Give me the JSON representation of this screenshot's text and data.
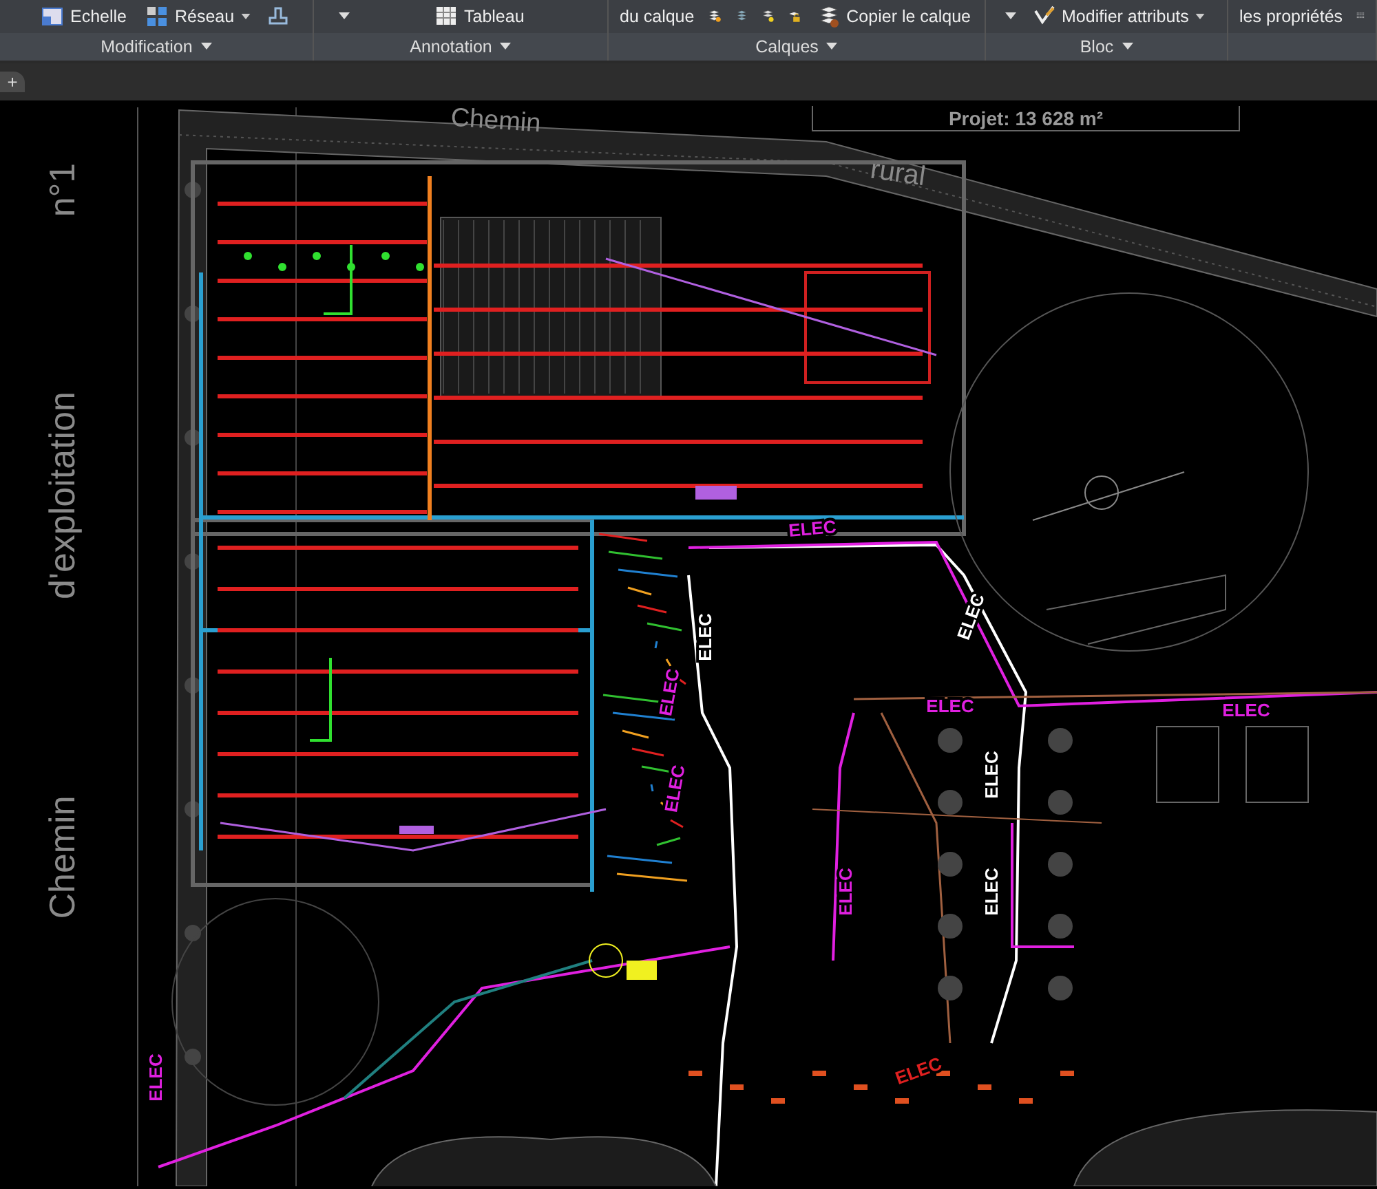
{
  "ribbon": {
    "panels": [
      {
        "title": "Modification",
        "tools": [
          {
            "kind": "button",
            "label": "Echelle"
          },
          {
            "kind": "dropdown",
            "label": "Réseau"
          },
          {
            "kind": "icon"
          }
        ]
      },
      {
        "title": "Annotation",
        "tools": [
          {
            "kind": "caret"
          },
          {
            "kind": "button",
            "label": "Tableau"
          }
        ]
      },
      {
        "title": "Calques",
        "tools": [
          {
            "kind": "text",
            "label": "du calque"
          },
          {
            "kind": "icon"
          },
          {
            "kind": "icon"
          },
          {
            "kind": "icon"
          },
          {
            "kind": "icon"
          },
          {
            "kind": "button",
            "label": "Copier le calque"
          }
        ]
      },
      {
        "title": "Bloc",
        "tools": [
          {
            "kind": "caret"
          },
          {
            "kind": "dropdown",
            "label": "Modifier attributs"
          }
        ]
      },
      {
        "tools": [
          {
            "kind": "text",
            "label": "les propriétés"
          },
          {
            "kind": "icon"
          }
        ]
      }
    ]
  },
  "file_tabs": [
    {
      "label": "+"
    }
  ],
  "drawing": {
    "road_labels": [
      "Chemin",
      "rural",
      "n°1",
      "d'exploitation",
      "Chemin"
    ],
    "area_label": "Projet: 13 628 m²",
    "cable_labels": [
      {
        "text": "ELEC",
        "color": "#e020e0"
      },
      {
        "text": "ELEC",
        "color": "#ffffff"
      },
      {
        "text": "ELEC",
        "color": "#e020e0"
      },
      {
        "text": "ELEC",
        "color": "#e020e0"
      },
      {
        "text": "ELEC",
        "color": "#ffffff"
      },
      {
        "text": "ELEC",
        "color": "#e020e0"
      },
      {
        "text": "ELEC",
        "color": "#e020e0"
      },
      {
        "text": "ELEC",
        "color": "#ffffff"
      },
      {
        "text": "ELEC",
        "color": "#ffffff"
      },
      {
        "text": "ELEC",
        "color": "#e020e0"
      },
      {
        "text": "ELEC",
        "color": "#e02020"
      },
      {
        "text": "ELEC",
        "color": "#e020e0"
      }
    ]
  }
}
